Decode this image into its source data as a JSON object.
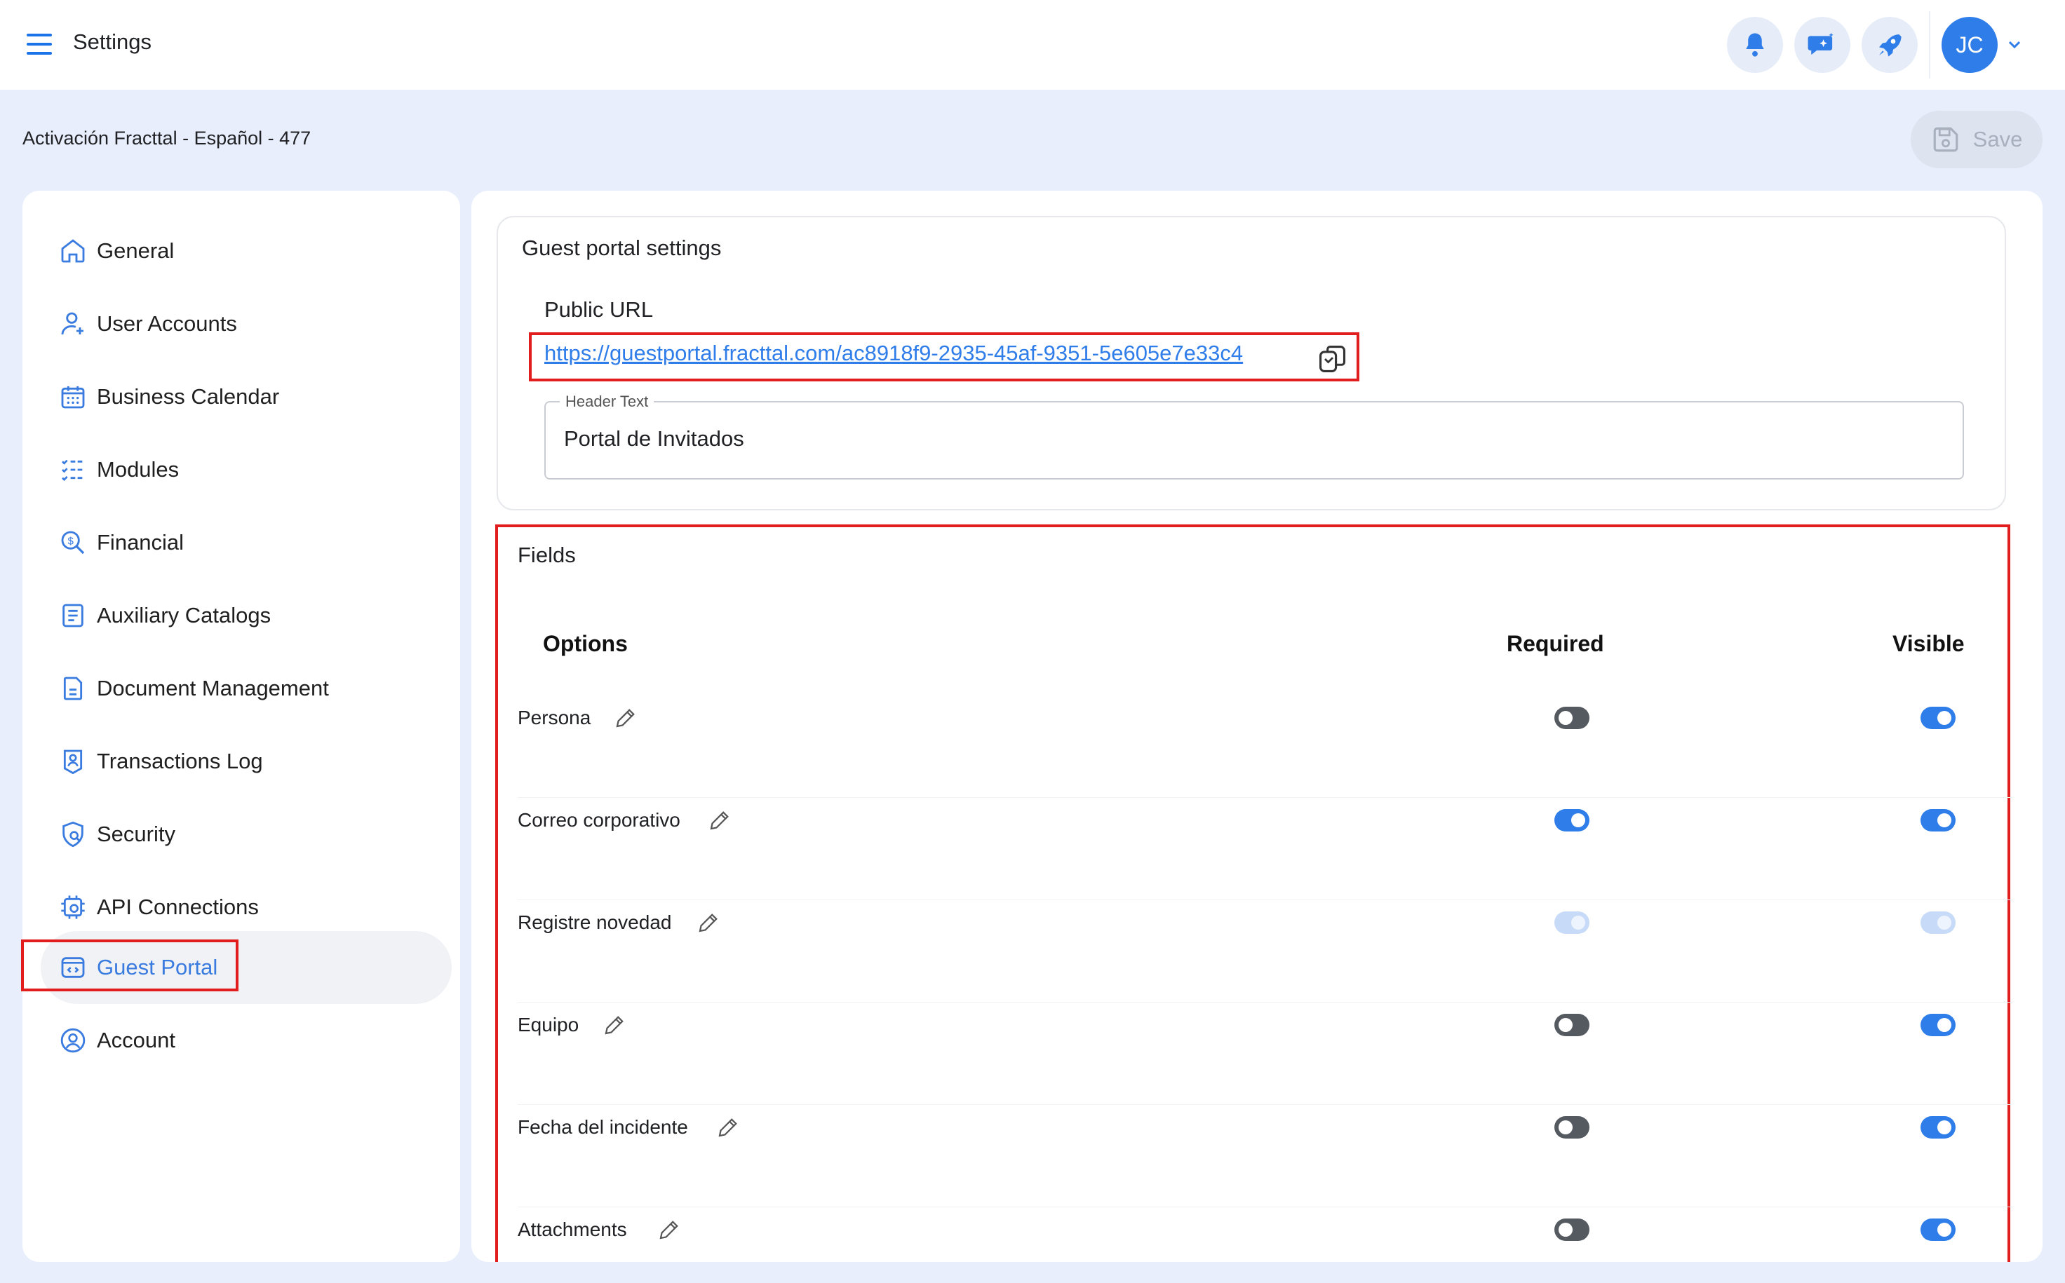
{
  "app": {
    "title": "Settings"
  },
  "header": {
    "avatar_initials": "JC",
    "icons": [
      "bell-icon",
      "chat-sparkle-icon",
      "rocket-icon"
    ]
  },
  "context": {
    "title": "Activación Fracttal - Español - 477",
    "save_label": "Save"
  },
  "sidebar": {
    "items": [
      {
        "label": "General",
        "icon": "home-icon"
      },
      {
        "label": "User Accounts",
        "icon": "user-add-icon"
      },
      {
        "label": "Business Calendar",
        "icon": "calendar-icon"
      },
      {
        "label": "Modules",
        "icon": "checklist-icon"
      },
      {
        "label": "Financial",
        "icon": "coin-search-icon"
      },
      {
        "label": "Auxiliary Catalogs",
        "icon": "catalog-icon"
      },
      {
        "label": "Document Management",
        "icon": "document-icon"
      },
      {
        "label": "Transactions Log",
        "icon": "log-icon"
      },
      {
        "label": "Security",
        "icon": "shield-search-icon"
      },
      {
        "label": "API Connections",
        "icon": "api-gear-icon"
      },
      {
        "label": "Guest Portal",
        "icon": "portal-code-icon",
        "active": true
      },
      {
        "label": "Account",
        "icon": "account-circle-icon"
      }
    ]
  },
  "guest_portal": {
    "card_title": "Guest portal settings",
    "public_url_label": "Public URL",
    "public_url": "https://guestportal.fracttal.com/ac8918f9-2935-45af-9351-5e605e7e33c4",
    "header_text_label": "Header Text",
    "header_text_value": "Portal de Invitados"
  },
  "fields": {
    "title": "Fields",
    "columns": {
      "options": "Options",
      "required": "Required",
      "visible": "Visible"
    },
    "rows": [
      {
        "label": "Persona",
        "required": false,
        "visible": true,
        "disabled": false
      },
      {
        "label": "Correo corporativo",
        "required": true,
        "visible": true,
        "disabled": false
      },
      {
        "label": "Registre novedad",
        "required": true,
        "visible": true,
        "disabled": true
      },
      {
        "label": "Equipo",
        "required": false,
        "visible": true,
        "disabled": false
      },
      {
        "label": "Fecha del incidente",
        "required": false,
        "visible": true,
        "disabled": false
      },
      {
        "label": "Attachments",
        "required": false,
        "visible": true,
        "disabled": false
      }
    ]
  },
  "colors": {
    "accent": "#2f7de9",
    "highlight_border": "#e21d1d",
    "page_bg": "#e8eefc"
  }
}
